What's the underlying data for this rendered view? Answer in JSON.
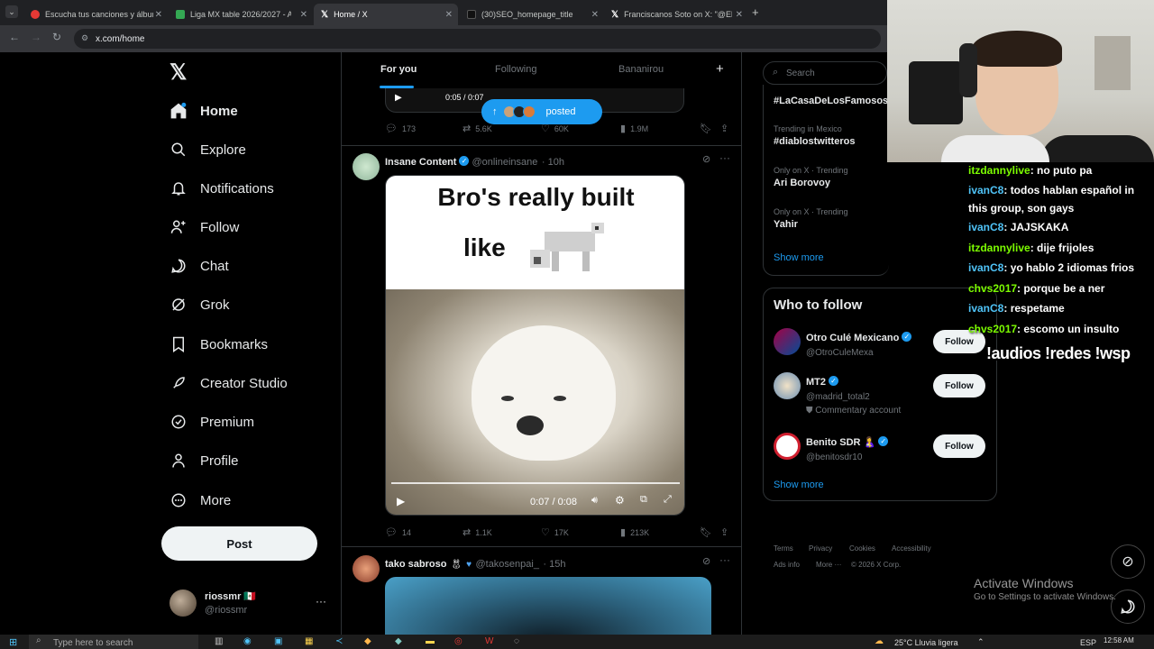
{
  "browser": {
    "tabs": [
      {
        "label": "Escucha tus canciones y álbum",
        "color": "#e53935"
      },
      {
        "label": "Liga MX table 2026/2027 - Ape",
        "color": "#34a853"
      },
      {
        "label": "Home / X",
        "color": "#ffffff"
      },
      {
        "label": "(30)SEO_homepage_title",
        "color": "#ffffff"
      },
      {
        "label": "Franciscanos Soto on X: \"@ElLi",
        "color": "#ffffff"
      }
    ],
    "url": "x.com/home"
  },
  "nav": {
    "items": [
      {
        "label": "Home",
        "icon": "home-icon"
      },
      {
        "label": "Explore",
        "icon": "search-icon"
      },
      {
        "label": "Notifications",
        "icon": "bell-icon"
      },
      {
        "label": "Follow",
        "icon": "follow-icon"
      },
      {
        "label": "Chat",
        "icon": "chat-icon"
      },
      {
        "label": "Grok",
        "icon": "grok-icon"
      },
      {
        "label": "Bookmarks",
        "icon": "bookmark-icon"
      },
      {
        "label": "Creator Studio",
        "icon": "rocket-icon"
      },
      {
        "label": "Premium",
        "icon": "verified-icon"
      },
      {
        "label": "Profile",
        "icon": "person-icon"
      },
      {
        "label": "More",
        "icon": "more-circle-icon"
      }
    ],
    "post_label": "Post",
    "account": {
      "name": "riossmr 🇲🇽",
      "handle": "@riossmr"
    }
  },
  "feed": {
    "tabs": [
      "For you",
      "Following",
      "Bananirou"
    ],
    "posted_pill": "posted",
    "prev_video_time": "0:05 / 0:07",
    "prev_metrics": {
      "replies": "173",
      "reposts": "5.6K",
      "likes": "60K",
      "views": "1.9M"
    },
    "tweet1": {
      "name": "Insane Content",
      "handle": "@onlineinsane",
      "time": "· 10h",
      "meme_line1": "Bro's really built",
      "meme_line2": "like",
      "video_time": "0:07 / 0:08",
      "metrics": {
        "replies": "14",
        "reposts": "1.1K",
        "likes": "17K",
        "views": "213K"
      }
    },
    "tweet2": {
      "name": "tako sabroso",
      "handle": "@takosenpai_",
      "time": "· 15h"
    }
  },
  "right": {
    "search_placeholder": "Search",
    "trends": [
      {
        "context": "",
        "name": "#LaCasaDeLosFamosos"
      },
      {
        "context": "Trending in Mexico",
        "name": "#diablostwitteros"
      },
      {
        "context": "Only on X · Trending",
        "name": "Ari Borovoy"
      },
      {
        "context": "Only on X · Trending",
        "name": "Yahir"
      }
    ],
    "show_more": "Show more",
    "who_to_follow": {
      "title": "Who to follow",
      "accounts": [
        {
          "name": "Otro Culé Mexicano",
          "handle": "@OtroCuleMexa",
          "note": "",
          "button": "Follow"
        },
        {
          "name": "MT2",
          "handle": "@madrid_total2",
          "note": "Commentary account",
          "button": "Follow"
        },
        {
          "name": "Benito SDR 🤱",
          "handle": "@benitosdr10",
          "note": "",
          "button": "Follow"
        }
      ],
      "show_more": "Show more"
    },
    "footer": {
      "links": [
        "Terms",
        "Privacy",
        "Cookies",
        "Accessibility",
        "Ads info",
        "More ···"
      ],
      "copyright": "© 2026 X Corp."
    }
  },
  "stream_chat": {
    "lines": [
      {
        "user": "itzdannylive",
        "msg": ": no puto pa",
        "color": "#7cfc00"
      },
      {
        "user": "ivanC8",
        "msg": ": todos hablan español in this group, son gays",
        "color": "#4fc3f7"
      },
      {
        "user": "ivanC8",
        "msg": ": JAJSKAKA",
        "color": "#4fc3f7"
      },
      {
        "user": "itzdannylive",
        "msg": ": dije frijoles",
        "color": "#7cfc00"
      },
      {
        "user": "ivanC8",
        "msg": ": yo hablo 2 idiomas frios",
        "color": "#4fc3f7"
      },
      {
        "user": "chvs2017",
        "msg": ": porque be a ner",
        "color": "#7cfc00"
      },
      {
        "user": "ivanC8",
        "msg": ": respetame",
        "color": "#4fc3f7"
      },
      {
        "user": "chvs2017",
        "msg": ": escomo un insulto",
        "color": "#7cfc00"
      }
    ],
    "commands": "!audios !redes !wsp"
  },
  "windows": {
    "activate_title": "Activate Windows",
    "activate_sub": "Go to Settings to activate Windows.",
    "search_placeholder": "Type here to search",
    "weather": "25°C Lluvia ligera",
    "lang": "ESP",
    "clock": "12:58 AM"
  }
}
